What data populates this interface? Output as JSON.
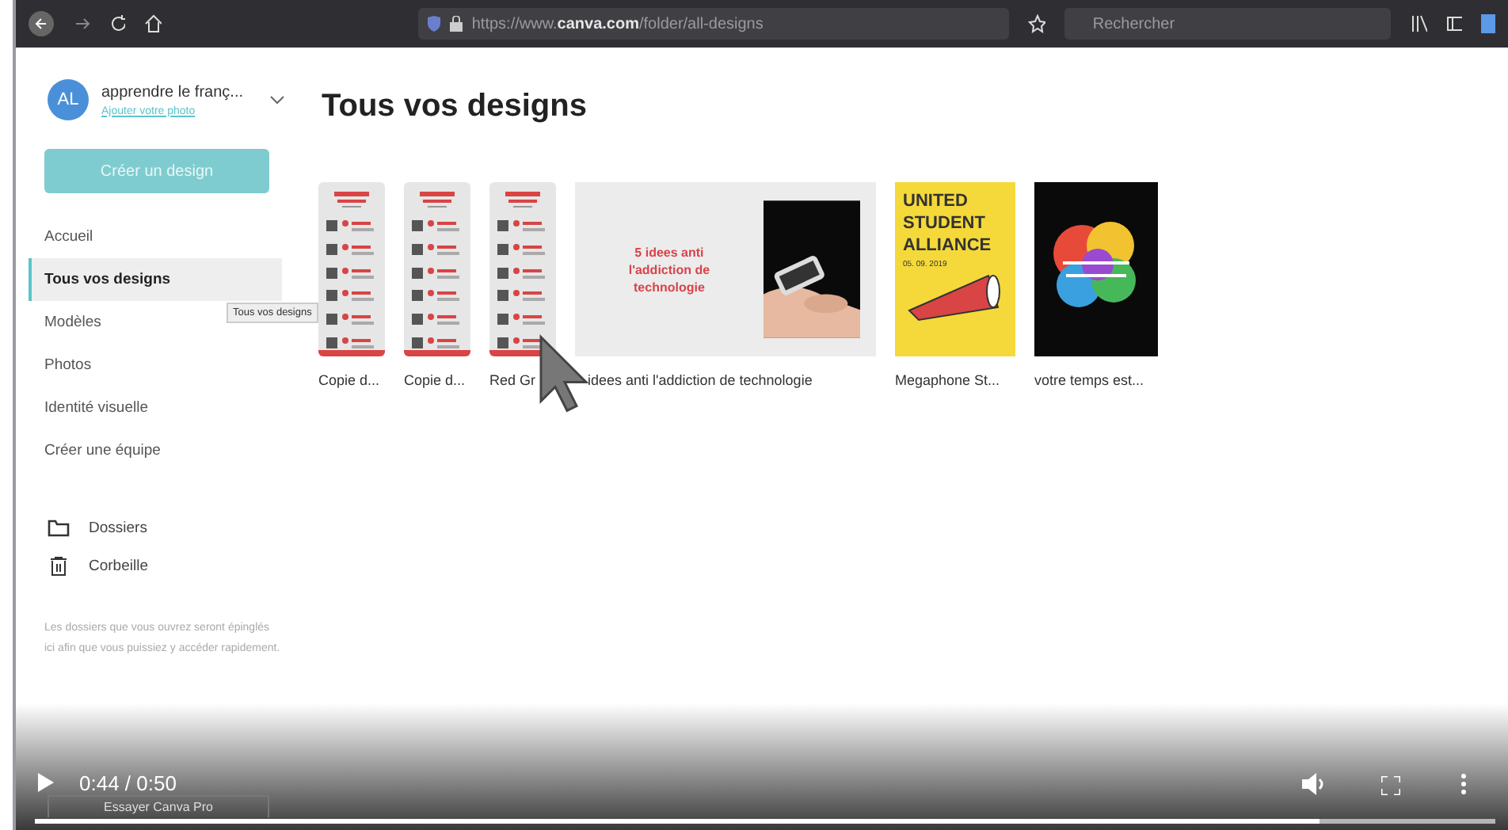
{
  "browser": {
    "url": "https://www.**canva.com**/folder/all-designs",
    "search": {
      "placeholder": "Rechercher"
    }
  },
  "account": {
    "initials": "AL",
    "name": "apprendre le franç...",
    "link": "Ajouter votre photo"
  },
  "create_button": "Créer un design",
  "nav": [
    {
      "label": "Accueil",
      "selected": false
    },
    {
      "label": "Tous vos designs",
      "selected": true
    },
    {
      "label": "Modèles",
      "selected": false
    },
    {
      "label": "Photos",
      "selected": false
    },
    {
      "label": "Identité visuelle",
      "selected": false
    },
    {
      "label": "Créer une équipe",
      "selected": false
    }
  ],
  "tooltip": "Tous vos designs",
  "folders": [
    {
      "kind": "folder",
      "label": "Dossiers"
    },
    {
      "kind": "trash",
      "label": "Corbeille"
    }
  ],
  "hint": "Les dossiers que vous ouvrez seront épinglés ici afin que vous puissiez y accéder rapidement.",
  "page_title": "Tous vos designs",
  "designs": [
    {
      "kind": "infographic",
      "caption": "Copie d..."
    },
    {
      "kind": "infographic",
      "caption": "Copie d..."
    },
    {
      "kind": "infographic",
      "caption": "Red Gr"
    },
    {
      "kind": "slide",
      "heading": "5 idees anti l'addiction de technologie",
      "caption": "idees anti l'addiction de technologie"
    },
    {
      "kind": "poster",
      "heading": "UNITED STUDENT ALLIANCE",
      "date": "05. 09. 2019",
      "caption": "Megaphone St..."
    },
    {
      "kind": "splash",
      "caption": "votre temps est..."
    }
  ],
  "pro_button": "Essayer Canva Pro",
  "player": {
    "time": "0:44 / 0:50",
    "level": 0.88
  }
}
